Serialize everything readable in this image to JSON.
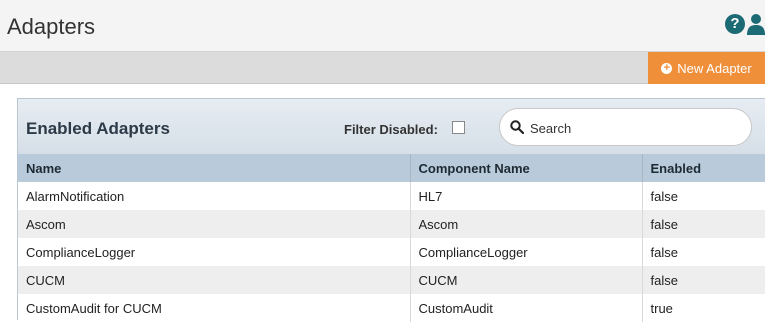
{
  "header": {
    "title": "Adapters",
    "help_icon": "?",
    "user_icon": "user-icon"
  },
  "toolbar": {
    "new_adapter_label": "New Adapter",
    "new_adapter_icon": "plus-circle-icon",
    "accent_color": "#ef8f3a"
  },
  "panel": {
    "title": "Enabled Adapters",
    "filter_label": "Filter Disabled:",
    "filter_checked": false,
    "search": {
      "placeholder": "Search",
      "value": ""
    }
  },
  "table": {
    "columns": [
      "Name",
      "Component Name",
      "Enabled"
    ],
    "rows": [
      [
        "AlarmNotification",
        "HL7",
        "false"
      ],
      [
        "Ascom",
        "Ascom",
        "false"
      ],
      [
        "ComplianceLogger",
        "ComplianceLogger",
        "false"
      ],
      [
        "CUCM",
        "CUCM",
        "false"
      ],
      [
        "CustomAudit for CUCM",
        "CustomAudit",
        "true"
      ]
    ]
  }
}
